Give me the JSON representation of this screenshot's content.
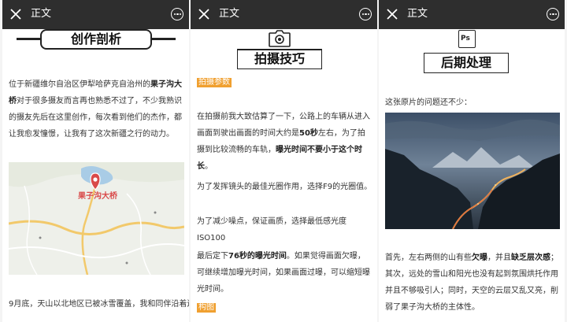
{
  "window": {
    "title": "正文"
  },
  "colors": {
    "topbar": "#2e2e2e",
    "tag_bg": "#f0a030",
    "map_pin": "#d94a4a"
  },
  "panel1": {
    "section_title": "创作剖析",
    "intro": {
      "t1": "位于新疆维尔自治区伊犁哈萨克自治州的",
      "b1": "果子沟大桥",
      "t2": "对于很多摄友而言再也熟悉不过了，不少我熟识的摄友先后在这里创作，每次看到他们的杰作，都让我愈发憧憬，让我有了这次新疆之行的动力。"
    },
    "map_label": "果子沟大桥",
    "bottom_text": "9月底，天山以北地区已被冰雪覆盖，我和同伴沿着连"
  },
  "panel2": {
    "section_title": "拍摄技巧",
    "tag_params": "拍摄参数",
    "para1": {
      "t1": "在拍摄前我大致估算了一下，公路上的车辆从进入画面到驶出画面的时间大约是",
      "b1": "50秒",
      "t2": "左右，为了拍摄到比较流畅的车轨，",
      "b2": "曝光时间不要小于这个时长",
      "t3": "。"
    },
    "para2": "为了发挥镜头的最佳光圈作用，选择F9的光圈值。",
    "para3": "为了减少噪点，保证画质，选择最低感光度ISO100",
    "para4": {
      "t1": "最后定下",
      "b1": "76秒的曝光时间",
      "t2": "。如果觉得画面欠曝，可继续增加曝光时间，如果画面过曝，可以缩短曝光时间。"
    },
    "tag_comp": "构图"
  },
  "panel3": {
    "section_title": "后期处理",
    "ps_label": "Ps",
    "intro": "这张原片的问题还不少：",
    "para": {
      "t1": "首先，左右两侧的山有些",
      "b1": "欠曝",
      "t2": "，并且",
      "b2": "缺乏层次感",
      "t3": "；其次，远处的雪山和阳光也没有起到氛围烘托作用并且不够吸引人；同时，天空的云层又乱又亮，削弱了果子沟大桥的主体性。"
    }
  }
}
